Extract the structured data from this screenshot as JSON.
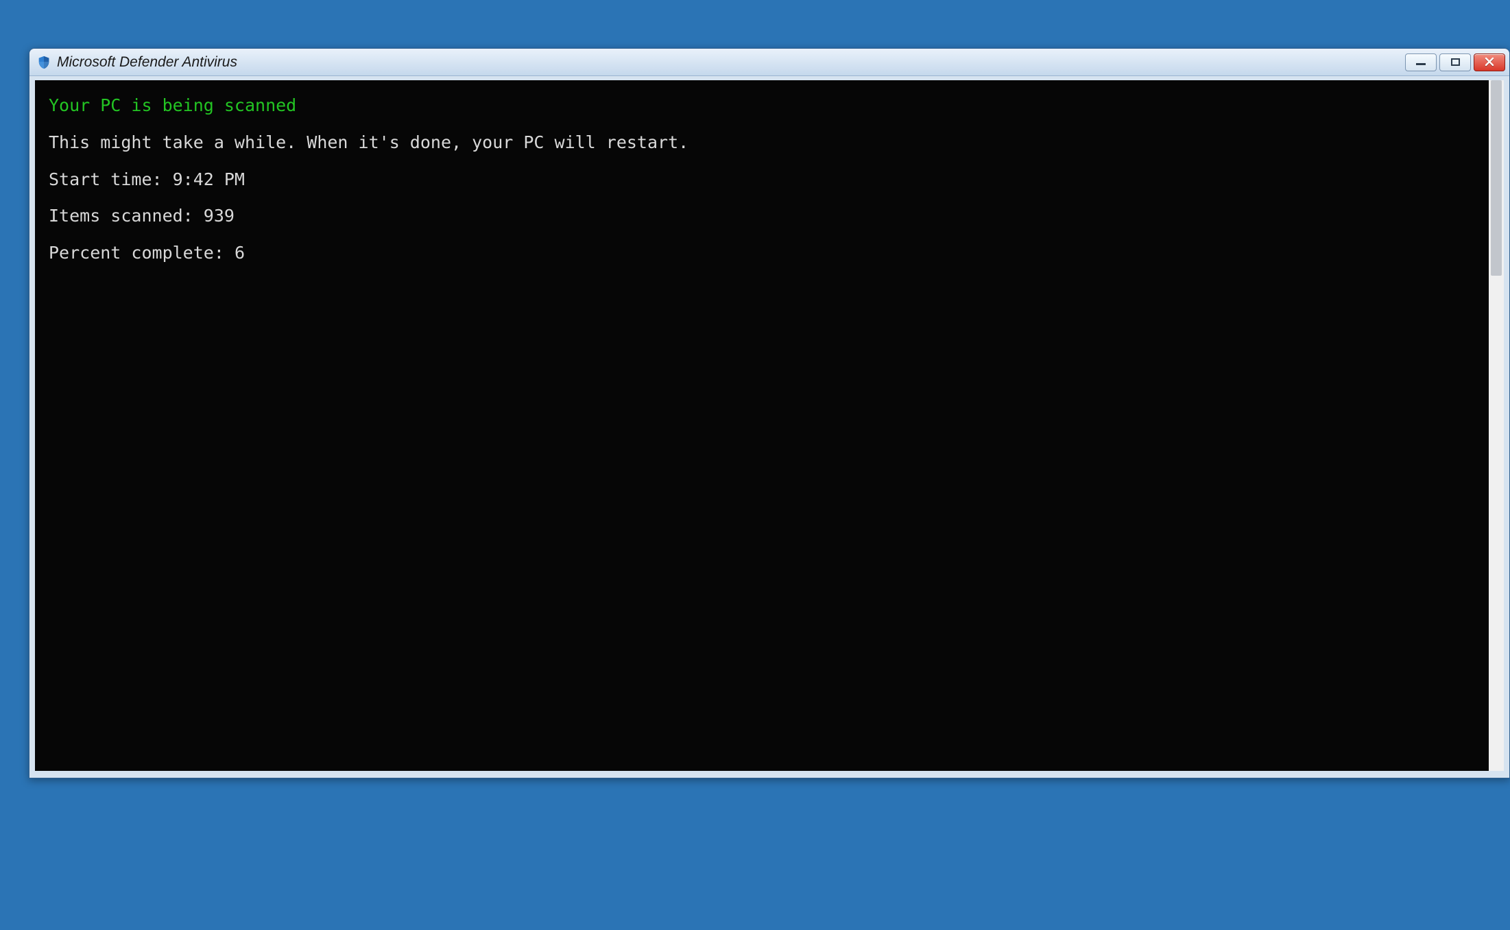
{
  "window": {
    "title": "Microsoft Defender Antivirus"
  },
  "console": {
    "headline": "Your PC is being scanned",
    "description": "This might take a while. When it's done, your PC will restart.",
    "start_time_label": "Start time: ",
    "start_time_value": "9:42 PM",
    "items_scanned_label": "Items scanned: ",
    "items_scanned_value": "939",
    "percent_complete_label": "Percent complete: ",
    "percent_complete_value": "6"
  }
}
